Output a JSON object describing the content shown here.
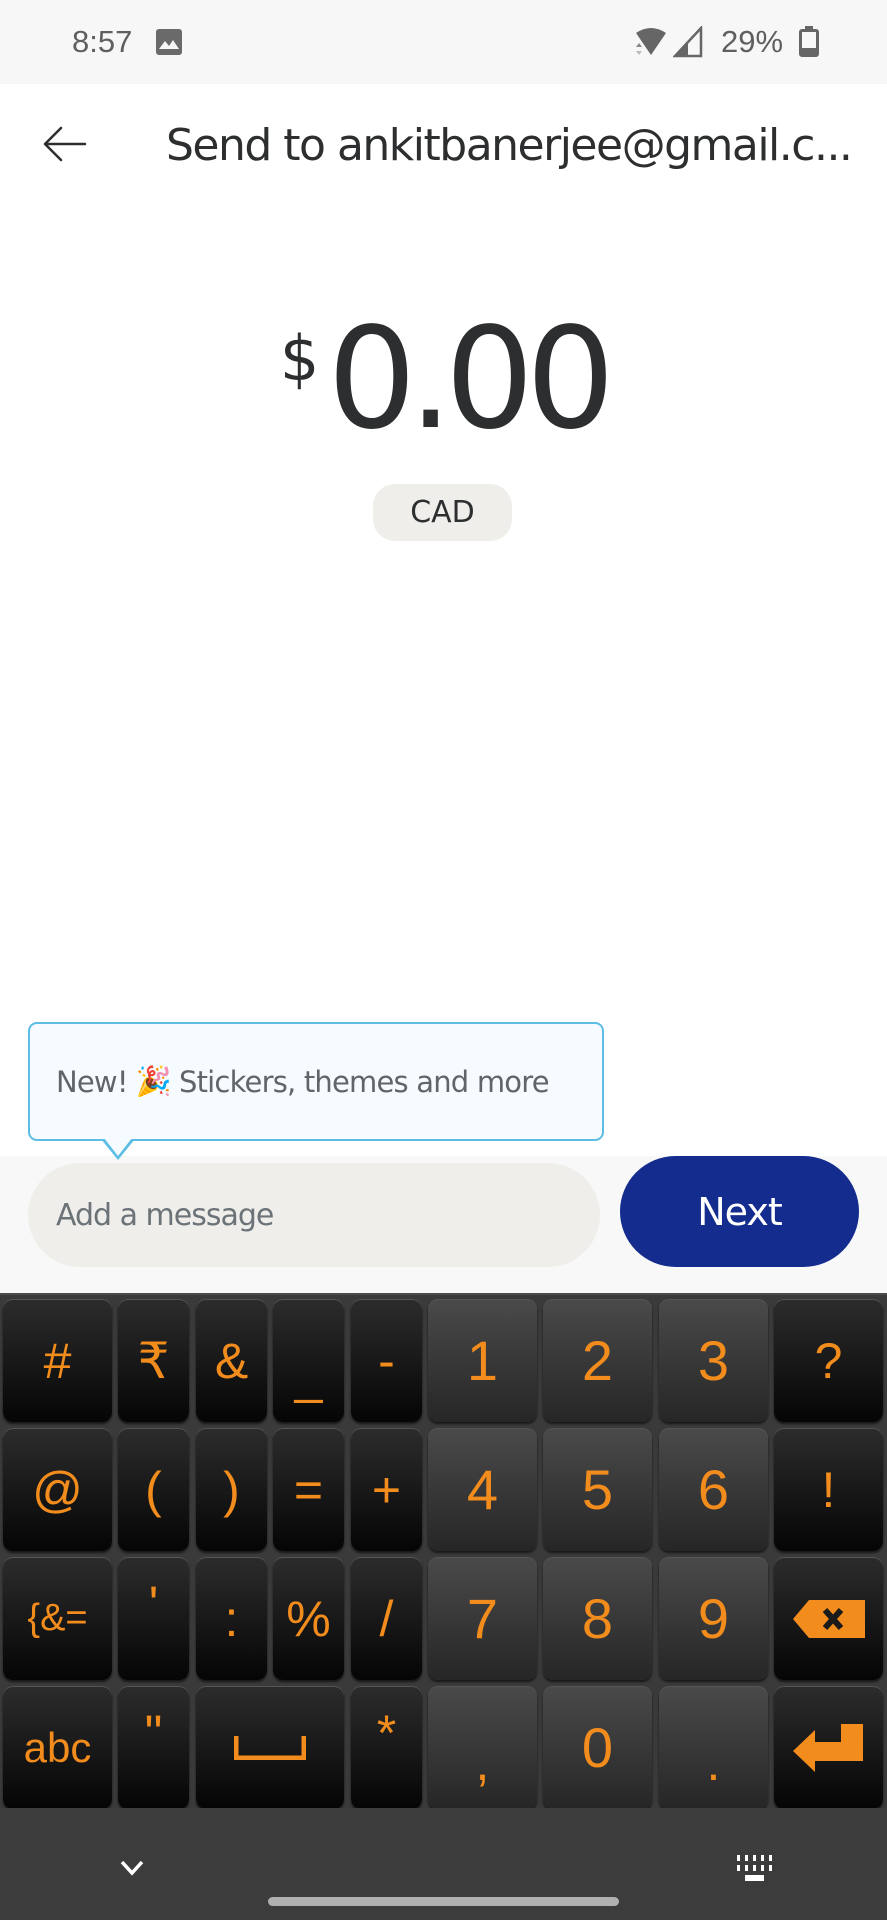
{
  "status_bar": {
    "time": "8:57",
    "battery_text": "29%",
    "battery_level": 0.29,
    "icons": [
      "image-notification-icon",
      "wifi-icon",
      "cell-signal-icon",
      "battery-icon"
    ]
  },
  "header": {
    "back_icon": "arrow-left-icon",
    "title": "Send to ankitbanerjee@gmail.c..."
  },
  "amount": {
    "currency_symbol": "$",
    "value": "0.00",
    "currency_code": "CAD"
  },
  "tooltip": {
    "prefix": "New!",
    "emoji": "🎉",
    "text": "Stickers, themes and more"
  },
  "message": {
    "value": "",
    "placeholder": "Add a message"
  },
  "next_button": {
    "label": "Next"
  },
  "colors": {
    "primary": "#142c8e",
    "key_text": "#f28c1c",
    "tooltip_border": "#5cbde5"
  },
  "keyboard": {
    "rows": [
      [
        "#",
        "₹",
        "&",
        "_",
        "-",
        "1",
        "2",
        "3",
        "?"
      ],
      [
        "@",
        "(",
        ")",
        "=",
        "+",
        "4",
        "5",
        "6",
        "!"
      ],
      [
        "{&=",
        "'",
        ":",
        "%",
        "/",
        "7",
        "8",
        "9",
        "backspace"
      ],
      [
        "abc",
        "\"",
        "space",
        "*",
        ",",
        "0",
        ".",
        "enter"
      ]
    ]
  },
  "nav_bar": {
    "left_icon": "chevron-down-icon",
    "right_icon": "keyboard-switch-icon"
  }
}
